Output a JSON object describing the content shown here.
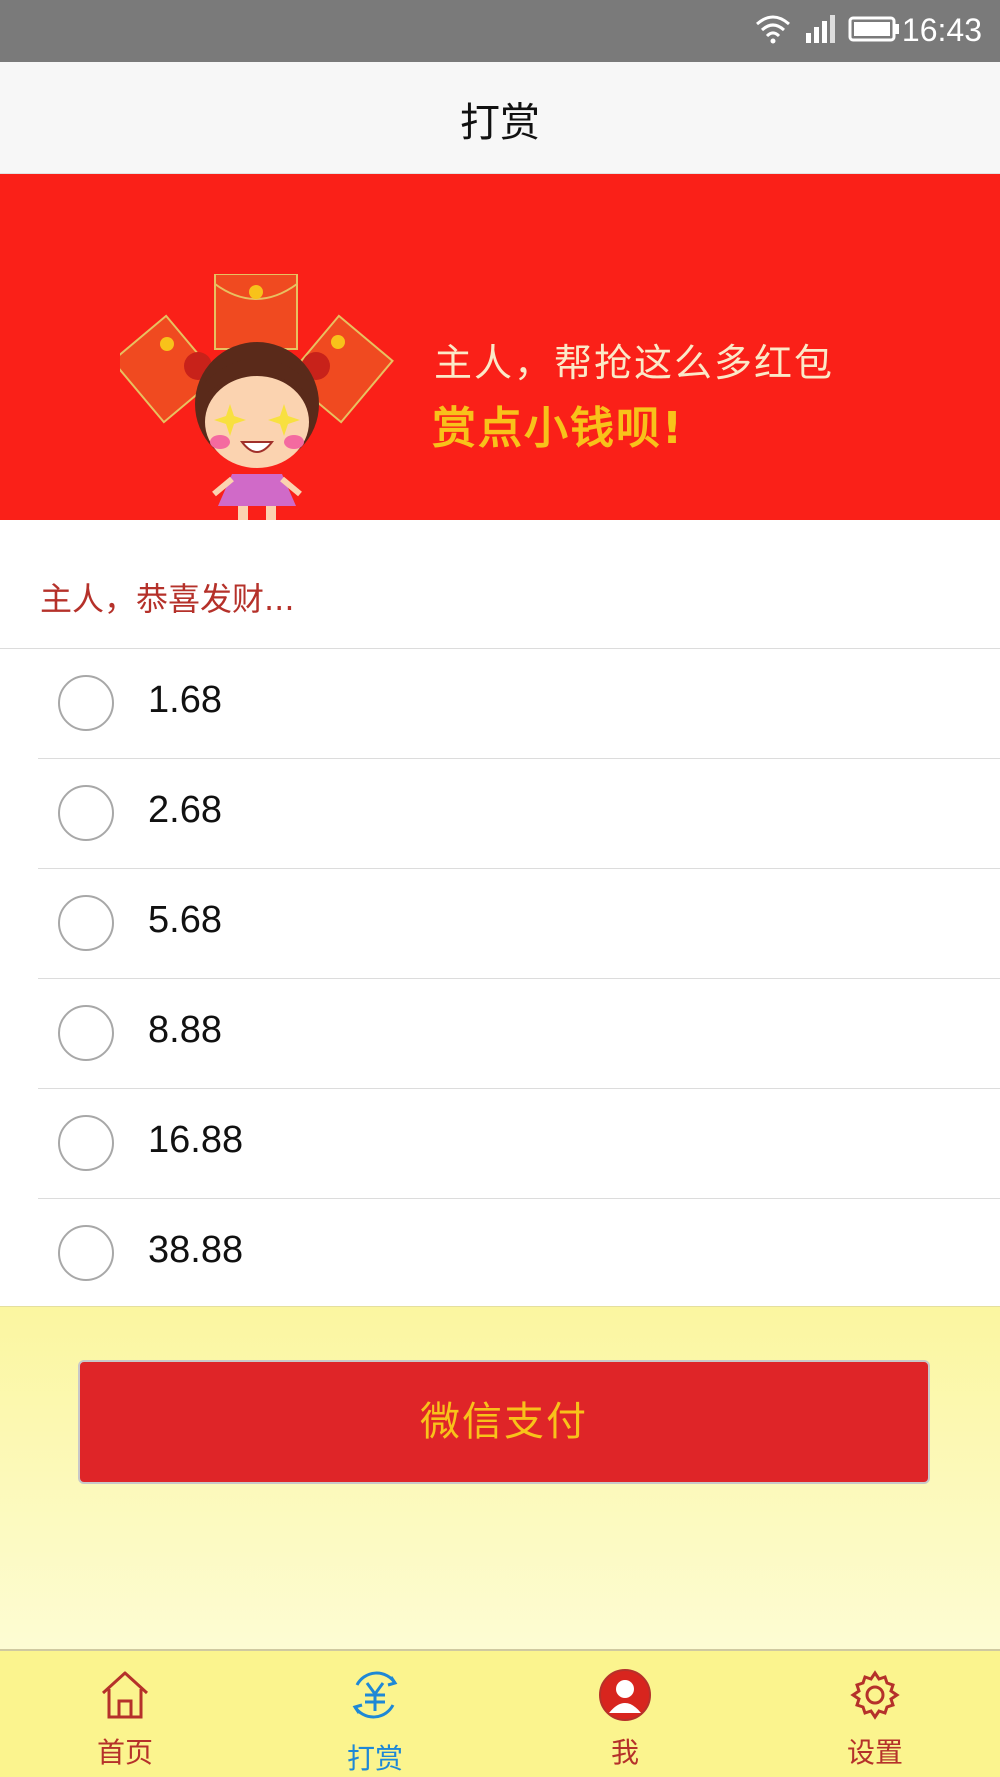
{
  "status_bar": {
    "time": "16:43"
  },
  "header": {
    "title": "打赏"
  },
  "banner": {
    "line1": "主人，帮抢这么多红包",
    "line2": "赏点小钱呗!"
  },
  "prompt": "主人，恭喜发财...",
  "amounts": [
    "1.68",
    "2.68",
    "5.68",
    "8.88",
    "16.88",
    "38.88"
  ],
  "pay_button": "微信支付",
  "tabs": [
    {
      "label": "首页",
      "icon": "home-icon"
    },
    {
      "label": "打赏",
      "icon": "yuan-icon",
      "active": true
    },
    {
      "label": "我",
      "icon": "user-icon"
    },
    {
      "label": "设置",
      "icon": "gear-icon"
    }
  ],
  "colors": {
    "banner_red": "#fa2018",
    "accent_gold": "#f8c21a",
    "prompt_red": "#b5312a",
    "pay_button": "#df2528",
    "tab_active": "#1e88d6"
  }
}
